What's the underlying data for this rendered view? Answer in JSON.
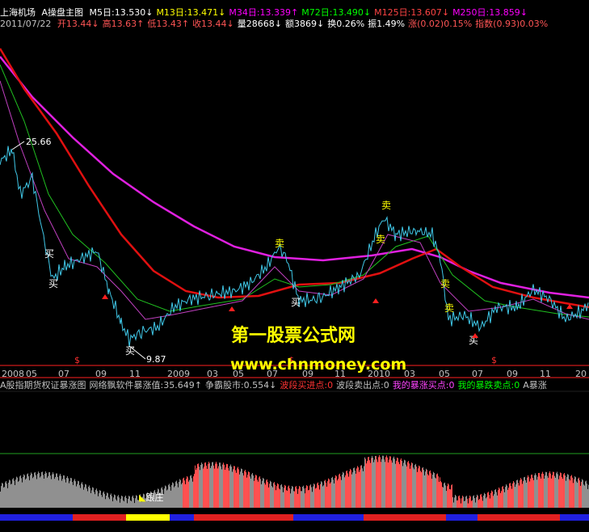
{
  "header": {
    "stock_name": "上海机场",
    "chart_name": "A操盘主图",
    "ma_items": [
      {
        "label": "M5日:13.530↓",
        "color": "#ffffff"
      },
      {
        "label": "M13日:13.471↓",
        "color": "#ffff00"
      },
      {
        "label": "M34日:13.339↑",
        "color": "#ff00ff"
      },
      {
        "label": "M72日:13.490↓",
        "color": "#00ff00"
      },
      {
        "label": "M125日:13.607↓",
        "color": "#ff4444"
      },
      {
        "label": "M250日:13.859↓",
        "color": "#ff00ff"
      }
    ]
  },
  "quote": {
    "date": "2011/07/22",
    "items": [
      {
        "label": "开13.44↓",
        "color": "#ff5555"
      },
      {
        "label": "高13.63↑",
        "color": "#ff5555"
      },
      {
        "label": "低13.43↑",
        "color": "#ff5555"
      },
      {
        "label": "收13.44↓",
        "color": "#ff5555"
      },
      {
        "label": "量28668↓",
        "color": "#ffffff"
      },
      {
        "label": "额3869↓",
        "color": "#ffffff"
      },
      {
        "label": "换0.26%",
        "color": "#ffffff"
      },
      {
        "label": "振1.49%",
        "color": "#ffffff"
      },
      {
        "label": "涨(0.02)0.15%",
        "color": "#ff5555"
      },
      {
        "label": "指数(0.93)0.03%",
        "color": "#ff5555"
      }
    ]
  },
  "annotations": {
    "high_price": "25.66",
    "low_price": "9.87",
    "buy_char": "买",
    "sell_char": "卖",
    "dollar": "$"
  },
  "x_axis": [
    "2008",
    "05",
    "07",
    "09",
    "11",
    "2009",
    "03",
    "05",
    "07",
    "09",
    "11",
    "2010",
    "03",
    "05",
    "07",
    "09",
    "11",
    "20"
  ],
  "indicator_bar": {
    "items": [
      {
        "label": "A股指期货权证暴涨图",
        "color": "#c0c0c0"
      },
      {
        "label": "网络飘软件暴涨值:35.649↑",
        "color": "#c0c0c0"
      },
      {
        "label": "争霸股市:0.554↓",
        "color": "#c0c0c0"
      },
      {
        "label": "波段买进点:0",
        "color": "#ff3333"
      },
      {
        "label": "波段卖出点:0",
        "color": "#c0c0c0"
      },
      {
        "label": "我的暴涨买点:0",
        "color": "#ff44ff"
      },
      {
        "label": "我的暴跌卖点:0",
        "color": "#00ff00"
      },
      {
        "label": "A暴涨",
        "color": "#c0c0c0"
      }
    ]
  },
  "watermark": {
    "line1": "第一股票公式网",
    "line2": "www.chnmoney.com"
  },
  "lower_panel": {
    "label": "跟庄"
  },
  "colors": {
    "background": "#000000",
    "axis_red": "#ff2020",
    "ma_red": "#e01010",
    "ma_magenta": "#e020e0",
    "ma_green": "#20c020",
    "price_cyan": "#40c8e8",
    "volume_gray": "#909090",
    "volume_red": "#ff5050"
  }
}
